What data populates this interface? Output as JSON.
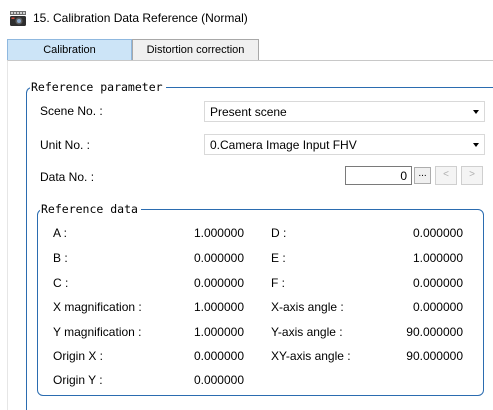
{
  "window": {
    "title": "15. Calibration Data Reference (Normal)",
    "icon": "calibration-app-icon"
  },
  "tabs": [
    {
      "label": "Calibration",
      "active": true
    },
    {
      "label": "Distortion correction",
      "active": false
    }
  ],
  "reference_parameter": {
    "group_label": "Reference parameter",
    "scene_label": "Scene No. :",
    "scene_value": "Present scene",
    "unit_label": "Unit No. :",
    "unit_value": "0.Camera Image Input FHV",
    "data_label": "Data No. :",
    "data_value": "0",
    "browse_label": "...",
    "prev_label": "<",
    "next_label": ">"
  },
  "reference_data": {
    "group_label": "Reference data",
    "rows": [
      {
        "left_label": "A :",
        "left_value": "1.000000",
        "right_label": "D :",
        "right_value": "0.000000"
      },
      {
        "left_label": "B :",
        "left_value": "0.000000",
        "right_label": "E :",
        "right_value": "1.000000"
      },
      {
        "left_label": "C :",
        "left_value": "0.000000",
        "right_label": "F :",
        "right_value": "0.000000"
      },
      {
        "left_label": "X magnification :",
        "left_value": "1.000000",
        "right_label": "X-axis angle :",
        "right_value": "0.000000"
      },
      {
        "left_label": "Y magnification :",
        "left_value": "1.000000",
        "right_label": "Y-axis angle :",
        "right_value": "90.000000"
      },
      {
        "left_label": "Origin X :",
        "left_value": "0.000000",
        "right_label": "XY-axis angle :",
        "right_value": "90.000000"
      },
      {
        "left_label": "Origin Y :",
        "left_value": "0.000000",
        "right_label": "",
        "right_value": ""
      }
    ]
  }
}
